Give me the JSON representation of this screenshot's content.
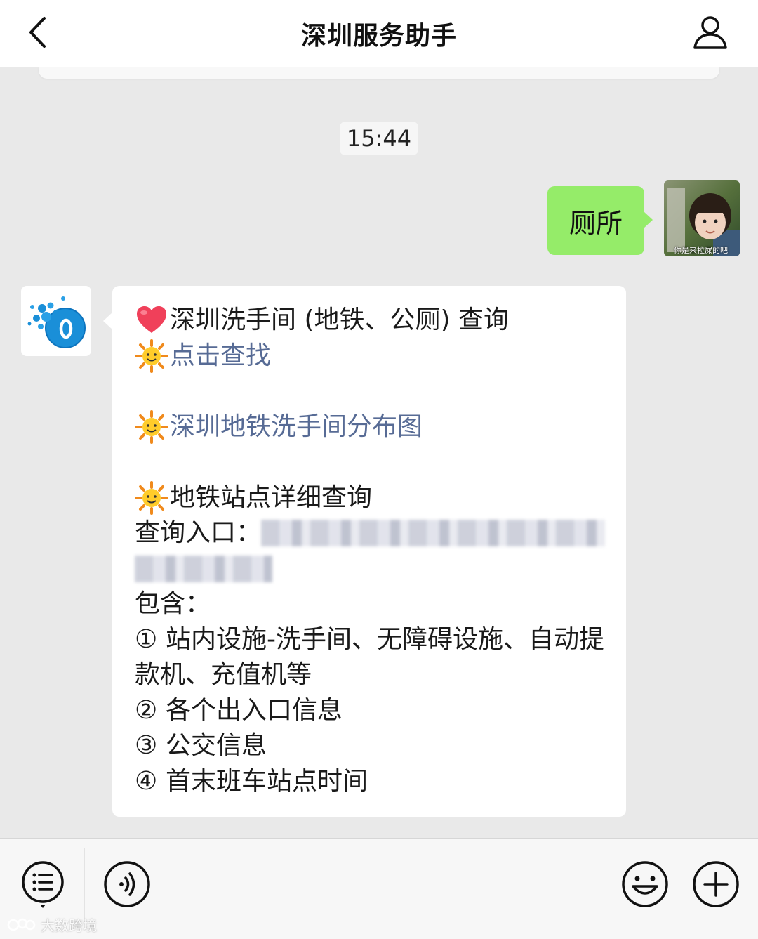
{
  "header": {
    "title": "深圳服务助手"
  },
  "chat": {
    "timestamp": "15:44",
    "sent_message": "厕所",
    "user_avatar_caption": "你是来拉屎的吧",
    "reply": {
      "line1": "深圳洗手间 (地铁、公厕) 查询",
      "link1": "点击查找",
      "link2": "深圳地铁洗手间分布图",
      "line4": "地铁站点详细查询",
      "entry_label": "查询入口：",
      "contains_label": "包含：",
      "items": [
        {
          "num": "①",
          "text": "站内设施-洗手间、无障碍设施、自动提款机、充值机等"
        },
        {
          "num": "②",
          "text": "各个出入口信息"
        },
        {
          "num": "③",
          "text": "公交信息"
        },
        {
          "num": "④",
          "text": "首末班车站点时间"
        }
      ]
    }
  },
  "watermark": {
    "text": "大数跨境"
  },
  "colors": {
    "sent_bubble": "#95ec69",
    "link": "#576b95",
    "chat_background": "#e9e9e9"
  },
  "icons": [
    "back-icon",
    "user-profile-icon",
    "heart-emoji",
    "sun-emoji",
    "menu-list-icon",
    "voice-icon",
    "emoji-face-icon",
    "plus-icon"
  ]
}
